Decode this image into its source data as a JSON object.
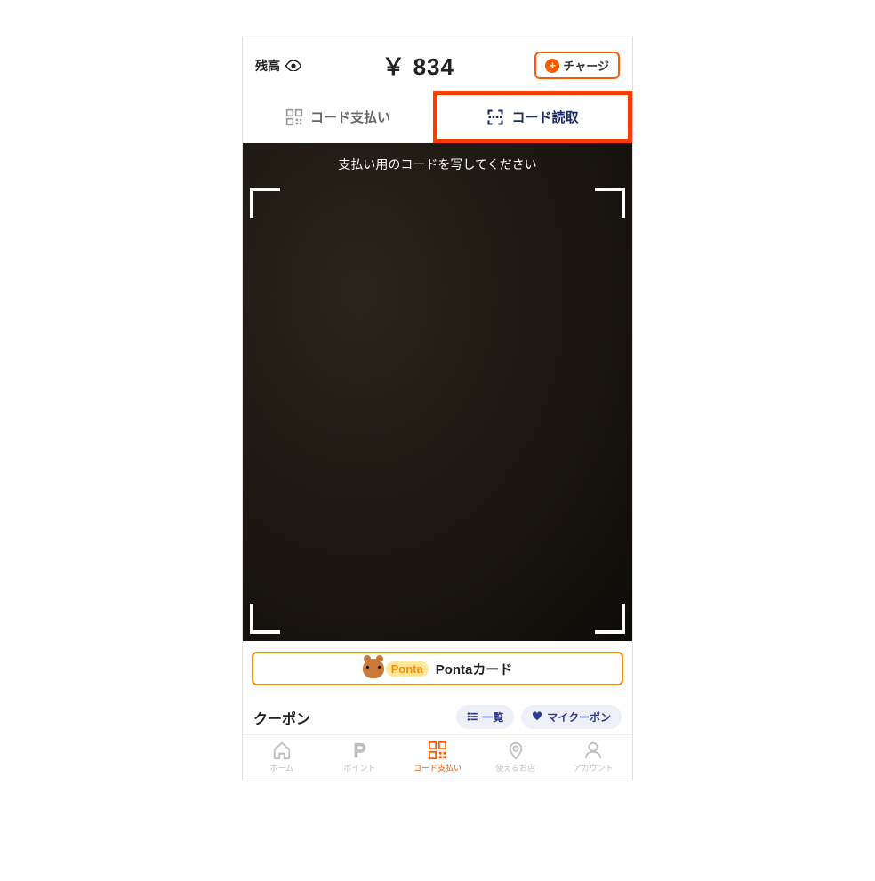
{
  "header": {
    "balance_label": "残高",
    "balance_amount": "￥ 834",
    "charge_label": "チャージ"
  },
  "tabs": {
    "pay_label": "コード支払い",
    "scan_label": "コード読取"
  },
  "scanner": {
    "instruction": "支払い用のコードを写してください"
  },
  "ponta": {
    "brand": "Ponta",
    "label": "Pontaカード"
  },
  "coupon": {
    "title": "クーポン",
    "list_label": "一覧",
    "my_label": "マイクーポン"
  },
  "nav": {
    "home": "ホーム",
    "point": "ポイント",
    "code_pay": "コード支払い",
    "stores": "使えるお店",
    "account": "アカウント"
  }
}
